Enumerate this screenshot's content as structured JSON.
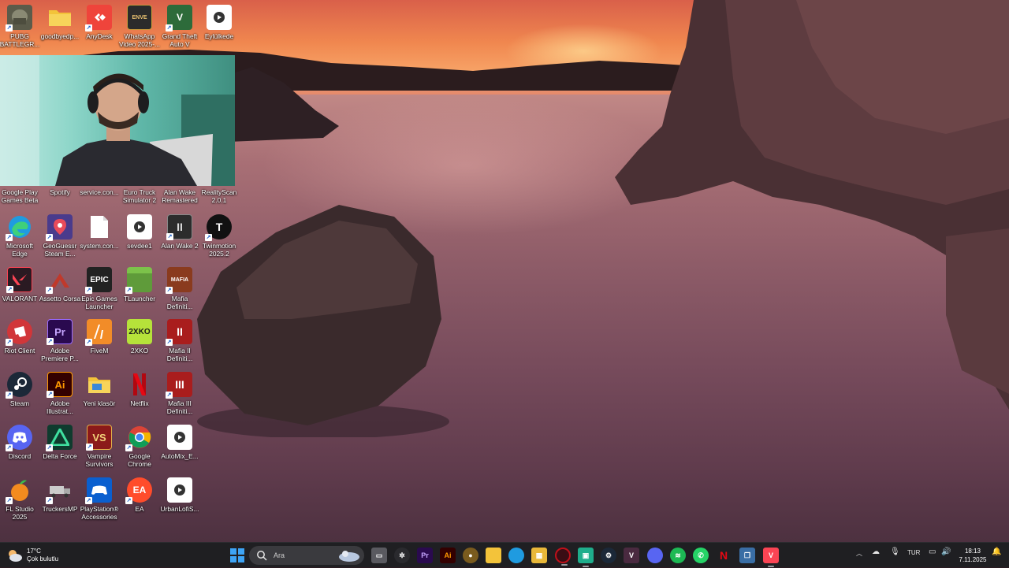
{
  "desktop": {
    "icons": [
      {
        "label": "PUBG BATTLEGR...",
        "icon": "pubg-icon",
        "color": "#5b5b4a"
      },
      {
        "label": "goodbyedp...",
        "icon": "folder-icon",
        "color": "#f3c33a"
      },
      {
        "label": "AnyDesk",
        "icon": "anydesk-icon",
        "color": "#ef443b"
      },
      {
        "label": "WhatsApp Video 2025-...",
        "icon": "video-file-icon",
        "color": "#2b2b2b"
      },
      {
        "label": "Grand Theft Auto V",
        "icon": "gta-icon",
        "color": "#2d6b3a"
      },
      {
        "label": "Eylülkede",
        "icon": "media-file-icon",
        "color": "#ffffff"
      },
      {
        "label": "Google Play Games Beta",
        "icon": "",
        "color": ""
      },
      {
        "label": "Spotify",
        "icon": "",
        "color": ""
      },
      {
        "label": "service.con...",
        "icon": "",
        "color": ""
      },
      {
        "label": "Euro Truck Simulator 2",
        "icon": "",
        "color": ""
      },
      {
        "label": "Alan Wake Remastered",
        "icon": "",
        "color": ""
      },
      {
        "label": "RealityScan 2.0.1",
        "icon": "",
        "color": ""
      },
      {
        "label": "Microsoft Edge",
        "icon": "edge-icon",
        "color": "#1f9be0"
      },
      {
        "label": "GeoGuessr Steam E...",
        "icon": "geoguessr-icon",
        "color": "#4a3b8c"
      },
      {
        "label": "system.con...",
        "icon": "text-file-icon",
        "color": "#ffffff"
      },
      {
        "label": "sevdee1",
        "icon": "media-file-icon",
        "color": "#ffffff"
      },
      {
        "label": "Alan Wake 2",
        "icon": "alan-wake-icon",
        "color": "#2c2c2c"
      },
      {
        "label": "Twinmotion 2025.2",
        "icon": "twinmotion-icon",
        "color": "#111111"
      },
      {
        "label": "VALORANT",
        "icon": "valorant-icon",
        "color": "#fa4454"
      },
      {
        "label": "Assetto Corsa",
        "icon": "assetto-icon",
        "color": "#c0392b"
      },
      {
        "label": "Epic Games Launcher",
        "icon": "epic-icon",
        "color": "#222222"
      },
      {
        "label": "TLauncher",
        "icon": "minecraft-icon",
        "color": "#5f9b3a"
      },
      {
        "label": "Mafia Definiti...",
        "icon": "mafia-icon",
        "color": "#8a3b1e"
      },
      {
        "label": "Riot Client",
        "icon": "riot-icon",
        "color": "#d13639"
      },
      {
        "label": "Adobe Premiere P...",
        "icon": "premiere-icon",
        "color": "#2a0a4f"
      },
      {
        "label": "FiveM",
        "icon": "fivem-icon",
        "color": "#f28c28"
      },
      {
        "label": "2XKO",
        "icon": "2xko-icon",
        "color": "#b6e23a"
      },
      {
        "label": "Mafia II Definiti...",
        "icon": "mafia2-icon",
        "color": "#a91d1d"
      },
      {
        "label": "Steam",
        "icon": "steam-icon",
        "color": "#1b2838"
      },
      {
        "label": "Adobe Illustrat...",
        "icon": "illustrator-icon",
        "color": "#330000"
      },
      {
        "label": "Yeni klasör",
        "icon": "folder-icon",
        "color": "#f3c33a"
      },
      {
        "label": "Netflix",
        "icon": "netflix-icon",
        "color": "#e50914"
      },
      {
        "label": "Mafia III Definiti...",
        "icon": "mafia3-icon",
        "color": "#a91d1d"
      },
      {
        "label": "Discord",
        "icon": "discord-icon",
        "color": "#5865f2"
      },
      {
        "label": "Delta Force",
        "icon": "delta-force-icon",
        "color": "#0f3b2e"
      },
      {
        "label": "Vampire Survivors",
        "icon": "vampire-icon",
        "color": "#8b1a1a"
      },
      {
        "label": "Google Chrome",
        "icon": "chrome-icon",
        "color": "#fbbc04"
      },
      {
        "label": "AutoMix_E...",
        "icon": "media-file-icon",
        "color": "#ffffff"
      },
      {
        "label": "FL Studio 2025",
        "icon": "flstudio-icon",
        "color": "#f38b1f"
      },
      {
        "label": "TruckersMP",
        "icon": "truckersmp-icon",
        "color": "#cccccc"
      },
      {
        "label": "PlayStation® Accessories",
        "icon": "playstation-icon",
        "color": "#0a5fcf"
      },
      {
        "label": "EA",
        "icon": "ea-icon",
        "color": "#ff4c2b"
      },
      {
        "label": "UrbanLofiS...",
        "icon": "media-file-icon",
        "color": "#ffffff"
      }
    ]
  },
  "taskbar": {
    "weather": {
      "temp": "17°C",
      "desc": "Çok bulutlu"
    },
    "search_placeholder": "Ara",
    "apps": [
      {
        "name": "task-view",
        "text": "",
        "color": "#5a5a60"
      },
      {
        "name": "chatgpt",
        "text": "",
        "color": "#2a2a2e"
      },
      {
        "name": "premiere",
        "text": "Pr",
        "color": "#2a0a4f"
      },
      {
        "name": "illustrator",
        "text": "Ai",
        "color": "#330000"
      },
      {
        "name": "geoguessr",
        "text": "",
        "color": "#7a5b1e"
      },
      {
        "name": "file-explorer",
        "text": "",
        "color": "#f3c33a"
      },
      {
        "name": "edge",
        "text": "",
        "color": "#1f9be0"
      },
      {
        "name": "store",
        "text": "",
        "color": "#e9b83a"
      },
      {
        "name": "obs",
        "text": "",
        "color": "#b0101a"
      },
      {
        "name": "app-green",
        "text": "",
        "color": "#1fae8c"
      },
      {
        "name": "steam",
        "text": "",
        "color": "#1b2838"
      },
      {
        "name": "valorant",
        "text": "",
        "color": "#4a2a40"
      },
      {
        "name": "discord",
        "text": "",
        "color": "#5865f2"
      },
      {
        "name": "spotify",
        "text": "",
        "color": "#1db954"
      },
      {
        "name": "whatsapp",
        "text": "",
        "color": "#25d366"
      },
      {
        "name": "netflix",
        "text": "",
        "color": "#e50914"
      },
      {
        "name": "window-switcher",
        "text": "",
        "color": "#3a6ea5"
      },
      {
        "name": "valorant-2",
        "text": "",
        "color": "#fa4454"
      }
    ],
    "tray": {
      "language": "TUR"
    },
    "clock": {
      "time": "18:13",
      "date": "7.11.2025"
    }
  }
}
